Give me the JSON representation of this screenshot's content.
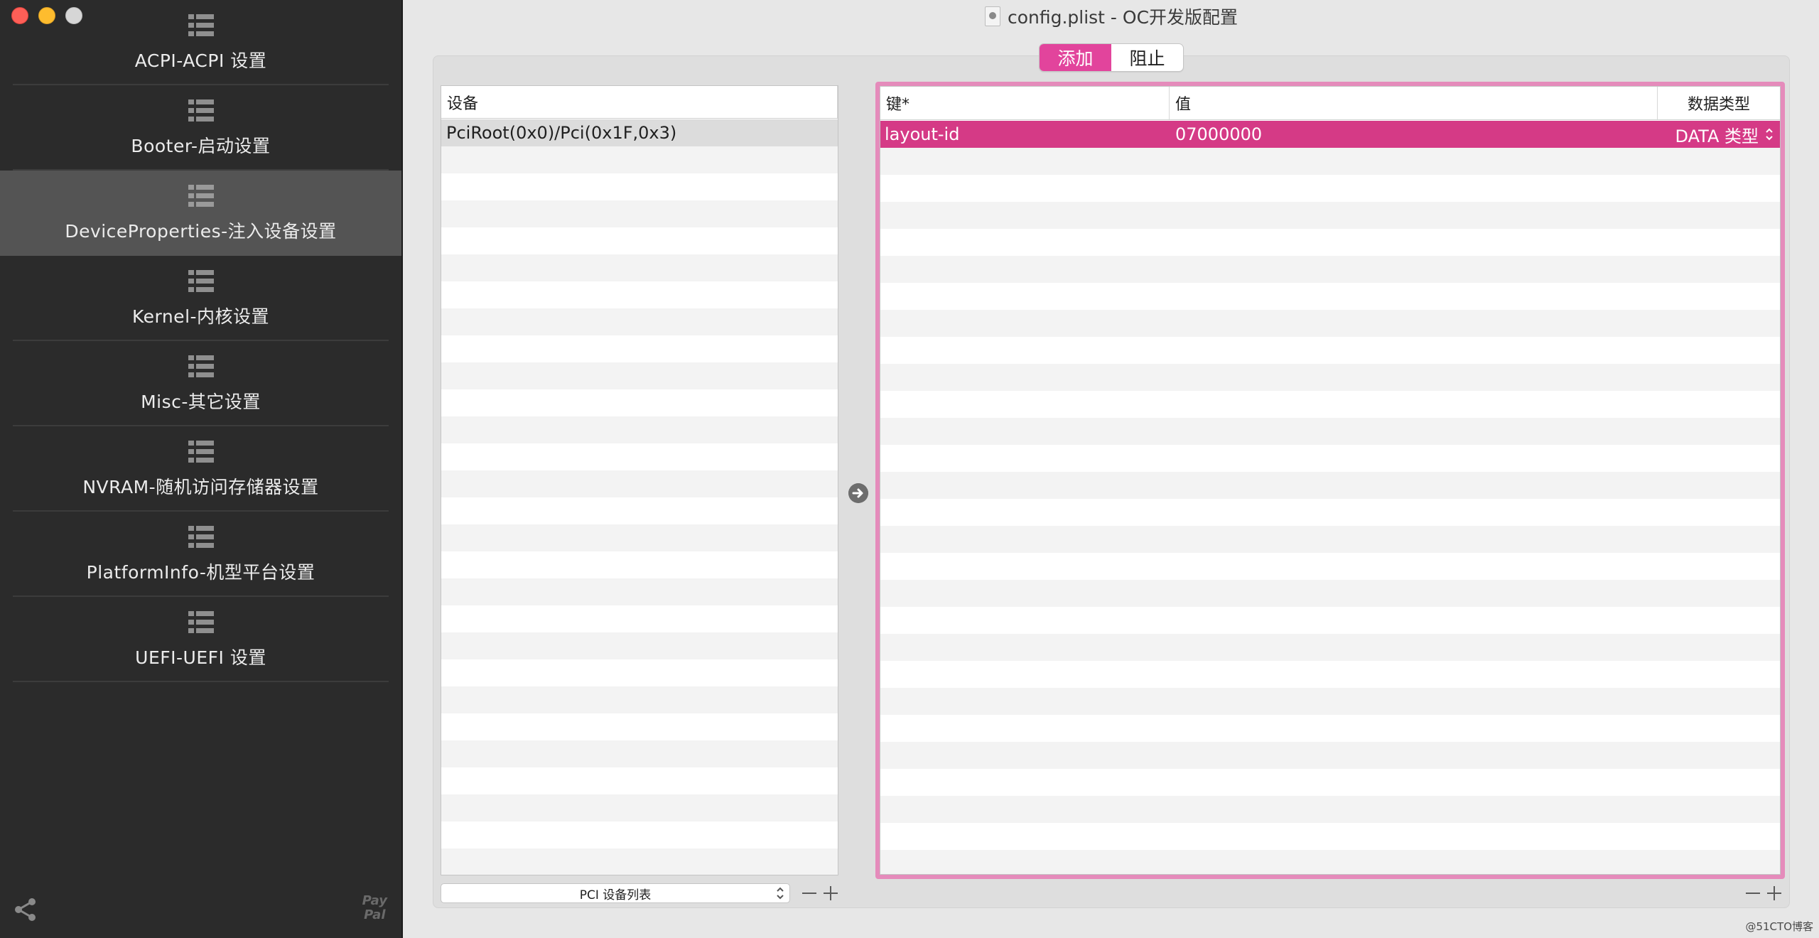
{
  "window": {
    "title": "config.plist - OC开发版配置"
  },
  "sidebar": {
    "items": [
      {
        "label": "ACPI-ACPI 设置",
        "active": false
      },
      {
        "label": "Booter-启动设置",
        "active": false
      },
      {
        "label": "DeviceProperties-注入设备设置",
        "active": true
      },
      {
        "label": "Kernel-内核设置",
        "active": false
      },
      {
        "label": "Misc-其它设置",
        "active": false
      },
      {
        "label": "NVRAM-随机访问存储器设置",
        "active": false
      },
      {
        "label": "PlatformInfo-机型平台设置",
        "active": false
      },
      {
        "label": "UEFI-UEFI 设置",
        "active": false
      }
    ],
    "paypal_line1": "Pay",
    "paypal_line2": "Pal"
  },
  "segmented": {
    "add": "添加",
    "block": "阻止",
    "selected": "add"
  },
  "devices_table": {
    "header": "设备",
    "rows": [
      "PciRoot(0x0)/Pci(0x1F,0x3)"
    ]
  },
  "properties_table": {
    "headers": {
      "key": "键*",
      "value": "值",
      "type": "数据类型"
    },
    "rows": [
      {
        "key": "layout-id",
        "value": "07000000",
        "type": "DATA 类型"
      }
    ]
  },
  "bottom": {
    "popup_label": "PCI 设备列表"
  },
  "watermark": "@51CTO博客",
  "colors": {
    "accent": "#e2449c",
    "selected_row": "#d53a86",
    "focus_ring": "#e58bbb",
    "sidebar_bg": "#2b2b2b"
  }
}
